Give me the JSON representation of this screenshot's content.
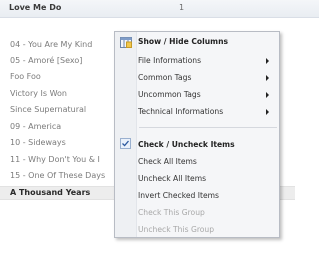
{
  "header": {
    "title": "Love Me Do",
    "count": "1"
  },
  "tracks": [
    "04 - You Are My Kind",
    "05 - Amoré [Sexo]",
    "Foo Foo",
    "Victory Is Won",
    "Since Supernatural",
    "09 - America",
    "10 - Sideways",
    "11 - Why Don't You & I",
    "15 - One Of These Days",
    "A Thousand Years"
  ],
  "menu": {
    "show_hide_columns": "Show / Hide Columns",
    "file_informations": "File Informations",
    "common_tags": "Common Tags",
    "uncommon_tags": "Uncommon Tags",
    "technical_informations": "Technical Informations",
    "check_uncheck_items": "Check / Uncheck Items",
    "check_all_items": "Check All Items",
    "uncheck_all_items": "Uncheck All Items",
    "invert_checked_items": "Invert Checked Items",
    "check_this_group": "Check This Group",
    "uncheck_this_group": "Uncheck This Group"
  },
  "icons": [
    "columns-icon",
    "checkbox-icon",
    "submenu-arrow-icon"
  ]
}
